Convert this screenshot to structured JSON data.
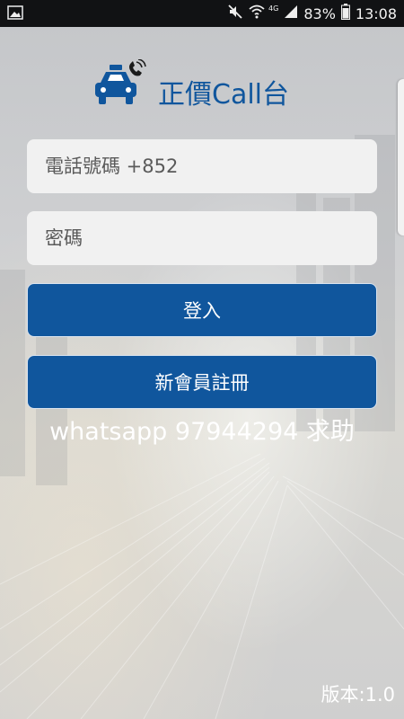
{
  "status_bar": {
    "network": "4G",
    "battery": "83%",
    "time": "13:08"
  },
  "app": {
    "title": "正價Call台",
    "logo_icon": "taxi-phone-icon",
    "brand_color": "#10569d"
  },
  "login": {
    "phone_placeholder": "電話號碼 +852",
    "password_placeholder": "密碼",
    "login_label": "登入",
    "register_label": "新會員註冊"
  },
  "help_text": "whatsapp 97944294 求助",
  "version_text": "版本:1.0"
}
